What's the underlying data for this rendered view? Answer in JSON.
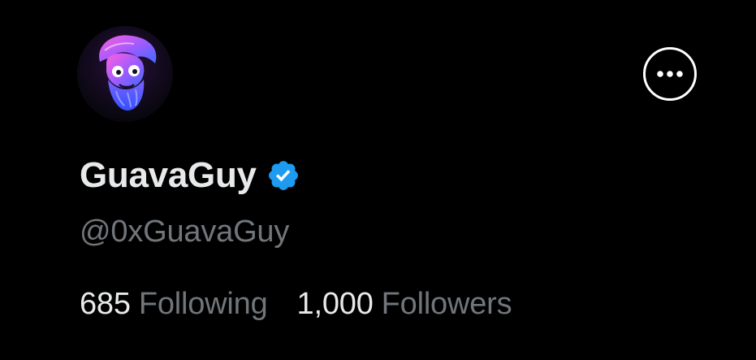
{
  "profile": {
    "display_name": "GuavaGuy",
    "handle": "@0xGuavaGuy",
    "verified": true,
    "verified_color": "#1d9bf0",
    "avatar_icon": "neon-statue-skull-avatar",
    "avatar_colors": [
      "#ff4fd8",
      "#8a5cff",
      "#4b7dff"
    ]
  },
  "stats": {
    "following_count": "685",
    "following_label": "Following",
    "followers_count": "1,000",
    "followers_label": "Followers"
  },
  "actions": {
    "more_icon": "more-horizontal-icon"
  },
  "colors": {
    "background": "#000000",
    "primary_text": "#e7e9ea",
    "secondary_text": "#71767b"
  }
}
